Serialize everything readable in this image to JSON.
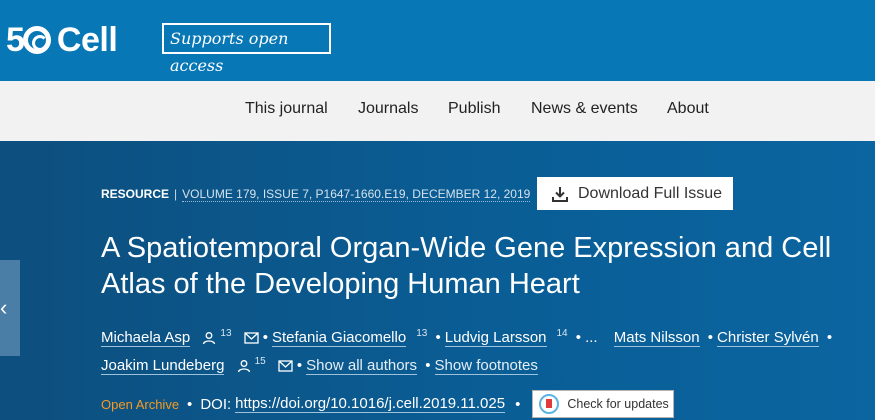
{
  "header": {
    "logo_number": "5",
    "logo_brand": "Cell",
    "open_access_label": "Supports open access"
  },
  "nav": {
    "items": [
      "This journal",
      "Journals",
      "Publish",
      "News & events",
      "About"
    ]
  },
  "article": {
    "type": "RESOURCE",
    "citation": "VOLUME 179, ISSUE 7, P1647-1660.E19, DECEMBER 12, 2019",
    "download_label": "Download Full Issue",
    "title": "A Spatiotemporal Organ-Wide Gene Expression and Cell Atlas of the Developing Human Heart",
    "authors": [
      {
        "name": "Michaela Asp",
        "sup": "13"
      },
      {
        "name": "Stefania Giacomello",
        "sup": "13"
      },
      {
        "name": "Ludvig Larsson",
        "sup": "14"
      },
      {
        "name": "Mats Nilsson"
      },
      {
        "name": "Christer Sylvén"
      },
      {
        "name": "Joakim Lundeberg",
        "sup": "15"
      }
    ],
    "ellipsis": "...",
    "show_all_authors": "Show all authors",
    "show_footnotes": "Show footnotes",
    "open_archive": "Open Archive",
    "doi_label": "DOI:",
    "doi": "https://doi.org/10.1016/j.cell.2019.11.025",
    "check_updates": "Check for updates"
  },
  "colors": {
    "topbar": "#0877b6",
    "hero": "#0a5d95",
    "open_archive": "#f59a23"
  }
}
